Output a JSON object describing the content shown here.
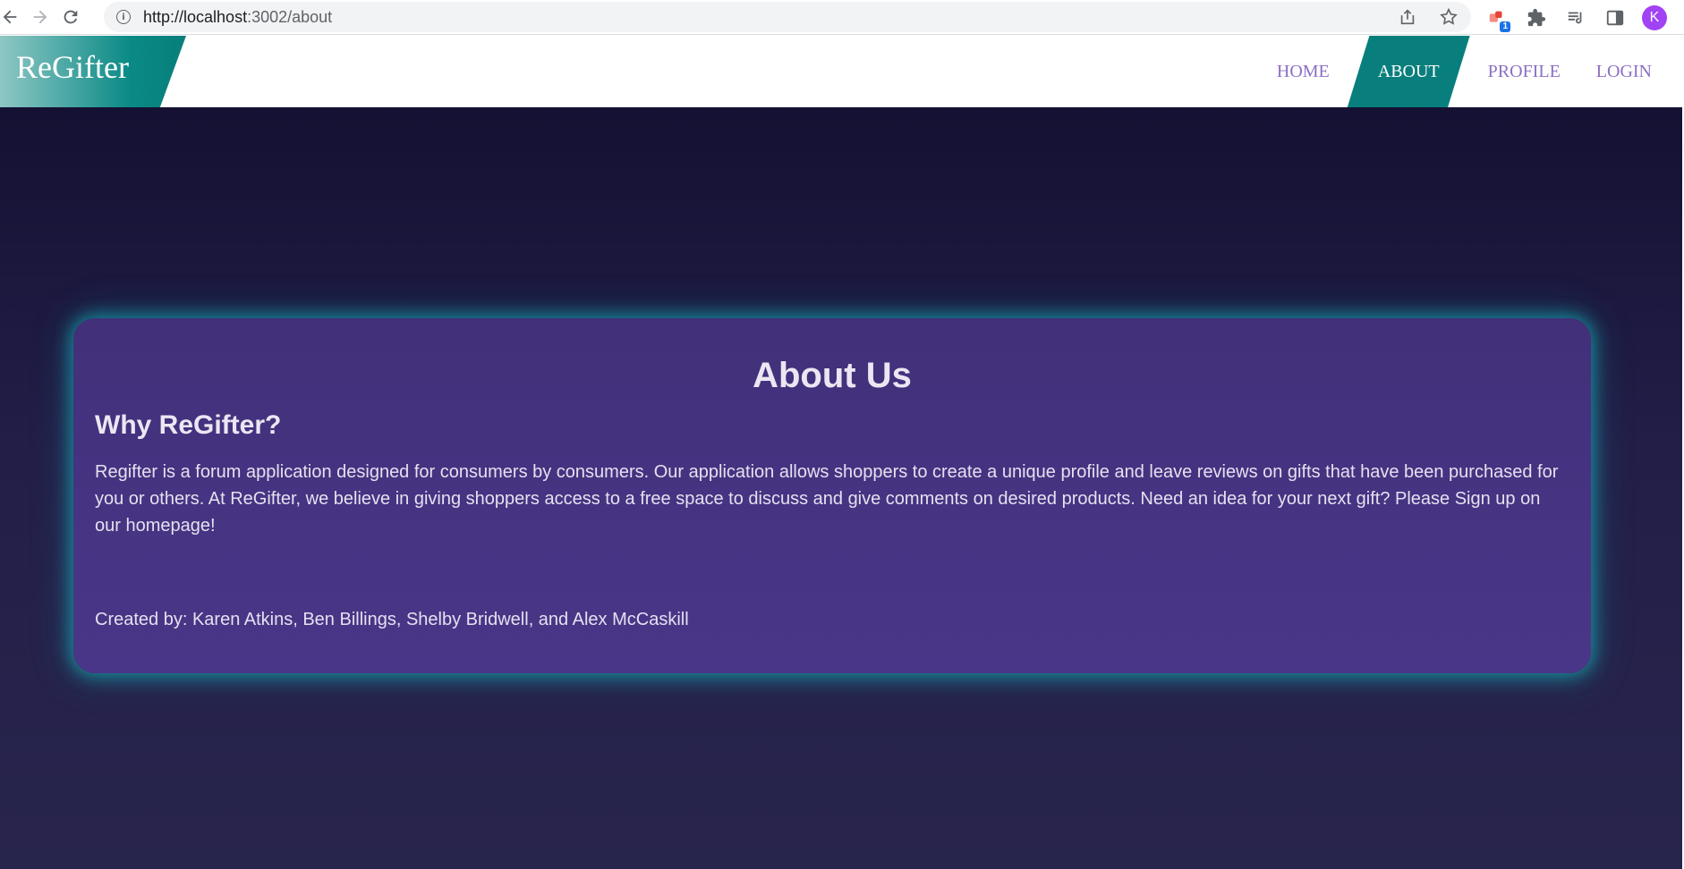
{
  "browser": {
    "url_host": "http://localhost",
    "url_path": ":3002/about",
    "extension_badge": "1",
    "profile_initial": "K"
  },
  "site": {
    "brand": "ReGifter",
    "nav": [
      {
        "label": "HOME",
        "active": false
      },
      {
        "label": "ABOUT",
        "active": true
      },
      {
        "label": "PROFILE",
        "active": false
      },
      {
        "label": "LOGIN",
        "active": false
      }
    ]
  },
  "about": {
    "title": "About Us",
    "subtitle": "Why ReGifter?",
    "description": "Regifter is a forum application designed for consumers by consumers. Our application allows shoppers to create a unique profile and leave reviews on gifts that have been purchased for you or others. At ReGifter, we believe in giving shoppers access to a free space to discuss and give comments on desired products. Need an idea for your next gift? Please Sign up on our homepage!",
    "credits": "Created by: Karen Atkins, Ben Billings, Shelby Bridwell, and Alex McCaskill"
  },
  "colors": {
    "brand_teal": "#087f7d",
    "nav_text": "#8c6fc4",
    "card_purple": "#4a3688",
    "page_bg": "#1c1840",
    "glow": "#14c8c8"
  }
}
